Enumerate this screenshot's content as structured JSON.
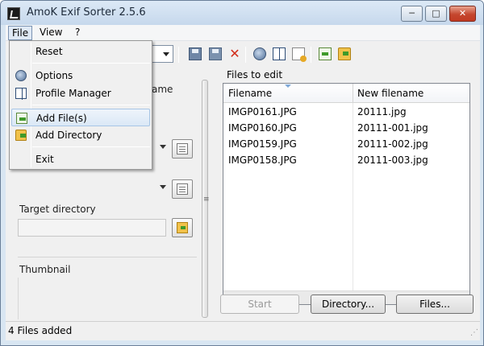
{
  "window": {
    "title": "AmoK Exif Sorter 2.5.6",
    "minimize": "─",
    "maximize": "□",
    "close": "✕"
  },
  "menubar": {
    "file": "File",
    "view": "View",
    "help": "?"
  },
  "file_menu": {
    "reset": "Reset",
    "options": "Options",
    "profile_manager": "Profile Manager",
    "add_files": "Add File(s)",
    "add_directory": "Add Directory",
    "exit": "Exit"
  },
  "toolbar": {
    "icons": [
      "save-icon",
      "save-as-icon",
      "delete-icon",
      "globe-icon",
      "book-icon",
      "document-icon",
      "add-file-icon",
      "add-folder-icon"
    ]
  },
  "left_panel": {
    "partial_label": "ame",
    "target_directory_label": "Target directory",
    "target_directory_value": "",
    "thumbnail_label": "Thumbnail"
  },
  "files_panel": {
    "label": "Files to edit",
    "columns": [
      "Filename",
      "New filename"
    ],
    "rows": [
      {
        "filename": "IMGP0161.JPG",
        "new_filename": "20111.jpg"
      },
      {
        "filename": "IMGP0160.JPG",
        "new_filename": "20111-001.jpg"
      },
      {
        "filename": "IMGP0159.JPG",
        "new_filename": "20111-002.jpg"
      },
      {
        "filename": "IMGP0158.JPG",
        "new_filename": "20111-003.jpg"
      }
    ]
  },
  "buttons": {
    "start": "Start",
    "directory": "Directory...",
    "files": "Files..."
  },
  "status": {
    "text": "4 Files added"
  }
}
